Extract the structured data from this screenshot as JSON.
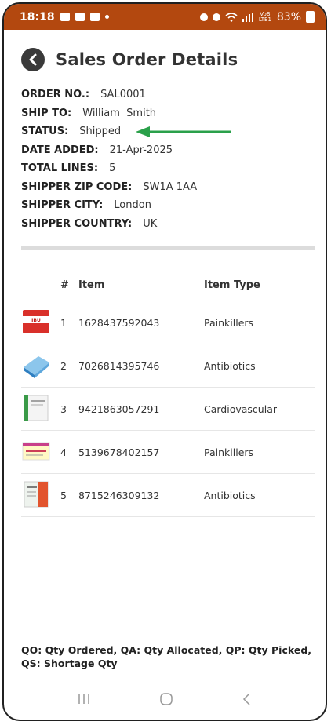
{
  "status_bar": {
    "time": "18:18",
    "battery": "83%",
    "network": "VoB LTE1"
  },
  "header": {
    "title": "Sales Order Details"
  },
  "order": {
    "order_no": {
      "label": "ORDER NO.:",
      "value": "SAL0001"
    },
    "ship_to": {
      "label": "SHIP TO:",
      "value": "William  Smith"
    },
    "status": {
      "label": "STATUS:",
      "value": "Shipped"
    },
    "date_added": {
      "label": "DATE ADDED:",
      "value": "21-Apr-2025"
    },
    "total_lines": {
      "label": "TOTAL LINES:",
      "value": "5"
    },
    "zip": {
      "label": "SHIPPER ZIP CODE:",
      "value": "SW1A 1AA"
    },
    "city": {
      "label": "SHIPPER CITY:",
      "value": "London"
    },
    "country": {
      "label": "SHIPPER COUNTRY:",
      "value": "UK"
    }
  },
  "table": {
    "headers": {
      "num": "#",
      "item": "Item",
      "type": "Item Type"
    },
    "rows": [
      {
        "num": "1",
        "item": "1628437592043",
        "type": "Painkillers"
      },
      {
        "num": "2",
        "item": "7026814395746",
        "type": "Antibiotics"
      },
      {
        "num": "3",
        "item": "9421863057291",
        "type": "Cardiovascular"
      },
      {
        "num": "4",
        "item": "5139678402157",
        "type": "Painkillers"
      },
      {
        "num": "5",
        "item": "8715246309132",
        "type": "Antibiotics"
      }
    ]
  },
  "legend": "QO: Qty Ordered, QA: Qty Allocated, QP: Qty Picked, QS: Shortage Qty",
  "colors": {
    "status_bar": "#b3480f",
    "arrow": "#2aa04a"
  }
}
